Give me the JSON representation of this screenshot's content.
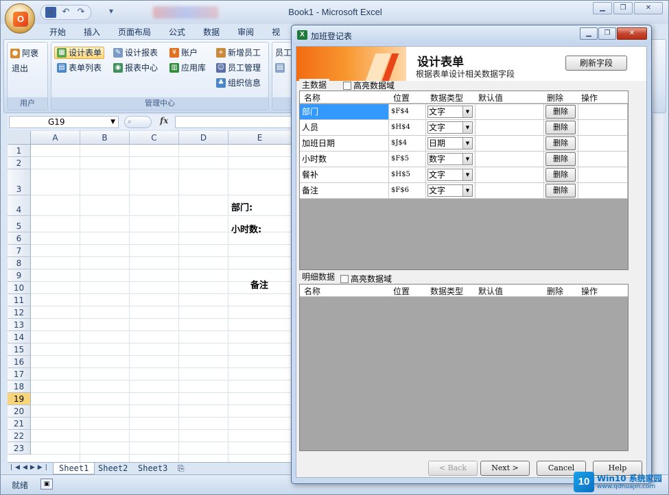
{
  "window": {
    "title": "Book1 - Microsoft Excel"
  },
  "ribbon_tabs": [
    "开始",
    "插入",
    "页面布局",
    "公式",
    "数据",
    "审阅",
    "视"
  ],
  "ribbon": {
    "user_group": {
      "label": "用户",
      "user": "阿褒",
      "logout": "退出"
    },
    "mgmt_group": {
      "label": "管理中心",
      "design_form": "设计表单",
      "form_list": "表单列表",
      "design_report": "设计报表",
      "report_center": "报表中心",
      "account": "账户",
      "app_library": "应用库",
      "add_employee": "新增员工",
      "employee_mgmt": "员工管理",
      "org_info": "组织信息"
    },
    "extra_group": {
      "first": "员工"
    }
  },
  "formula_bar": {
    "name_box": "G19",
    "fx": "fx"
  },
  "sheet": {
    "columns": [
      "A",
      "B",
      "C",
      "D",
      "E"
    ],
    "rows": [
      "1",
      "2",
      "3",
      "4",
      "5",
      "6",
      "7",
      "8",
      "9",
      "10",
      "11",
      "12",
      "13",
      "14",
      "15",
      "16",
      "17",
      "18",
      "19",
      "20",
      "21",
      "22",
      "23"
    ],
    "selected_row": "19",
    "labels": {
      "dept": "部门:",
      "hours": "小时数:",
      "note": "备注"
    }
  },
  "sheet_tabs": [
    "Sheet1",
    "Sheet2",
    "Sheet3"
  ],
  "status": {
    "ready": "就绪"
  },
  "dialog": {
    "title": "加班登记表",
    "heading": "设计表单",
    "subheading": "根据表单设计相关数据字段",
    "refresh_button": "刷新字段",
    "main_section": "主数据",
    "detail_section": "明细数据",
    "highlight_checkbox": "高亮数据域",
    "columns": [
      "名称",
      "位置",
      "数据类型",
      "默认值",
      "删除",
      "操作"
    ],
    "delete_label": "删除",
    "main_rows": [
      {
        "name": "部门",
        "pos": "$F$4",
        "type": "文字"
      },
      {
        "name": "人员",
        "pos": "$H$4",
        "type": "文字"
      },
      {
        "name": "加班日期",
        "pos": "$J$4",
        "type": "日期"
      },
      {
        "name": "小时数",
        "pos": "$F$5",
        "type": "数字"
      },
      {
        "name": "餐补",
        "pos": "$H$5",
        "type": "文字"
      },
      {
        "name": "备注",
        "pos": "$F$6",
        "type": "文字"
      }
    ],
    "buttons": {
      "back": "< Back",
      "next": "Next >",
      "cancel": "Cancel",
      "help": "Help"
    }
  },
  "watermark": {
    "brand": "Win10 系统家园",
    "url": "www.qdhuajin.com",
    "logo": "10"
  }
}
